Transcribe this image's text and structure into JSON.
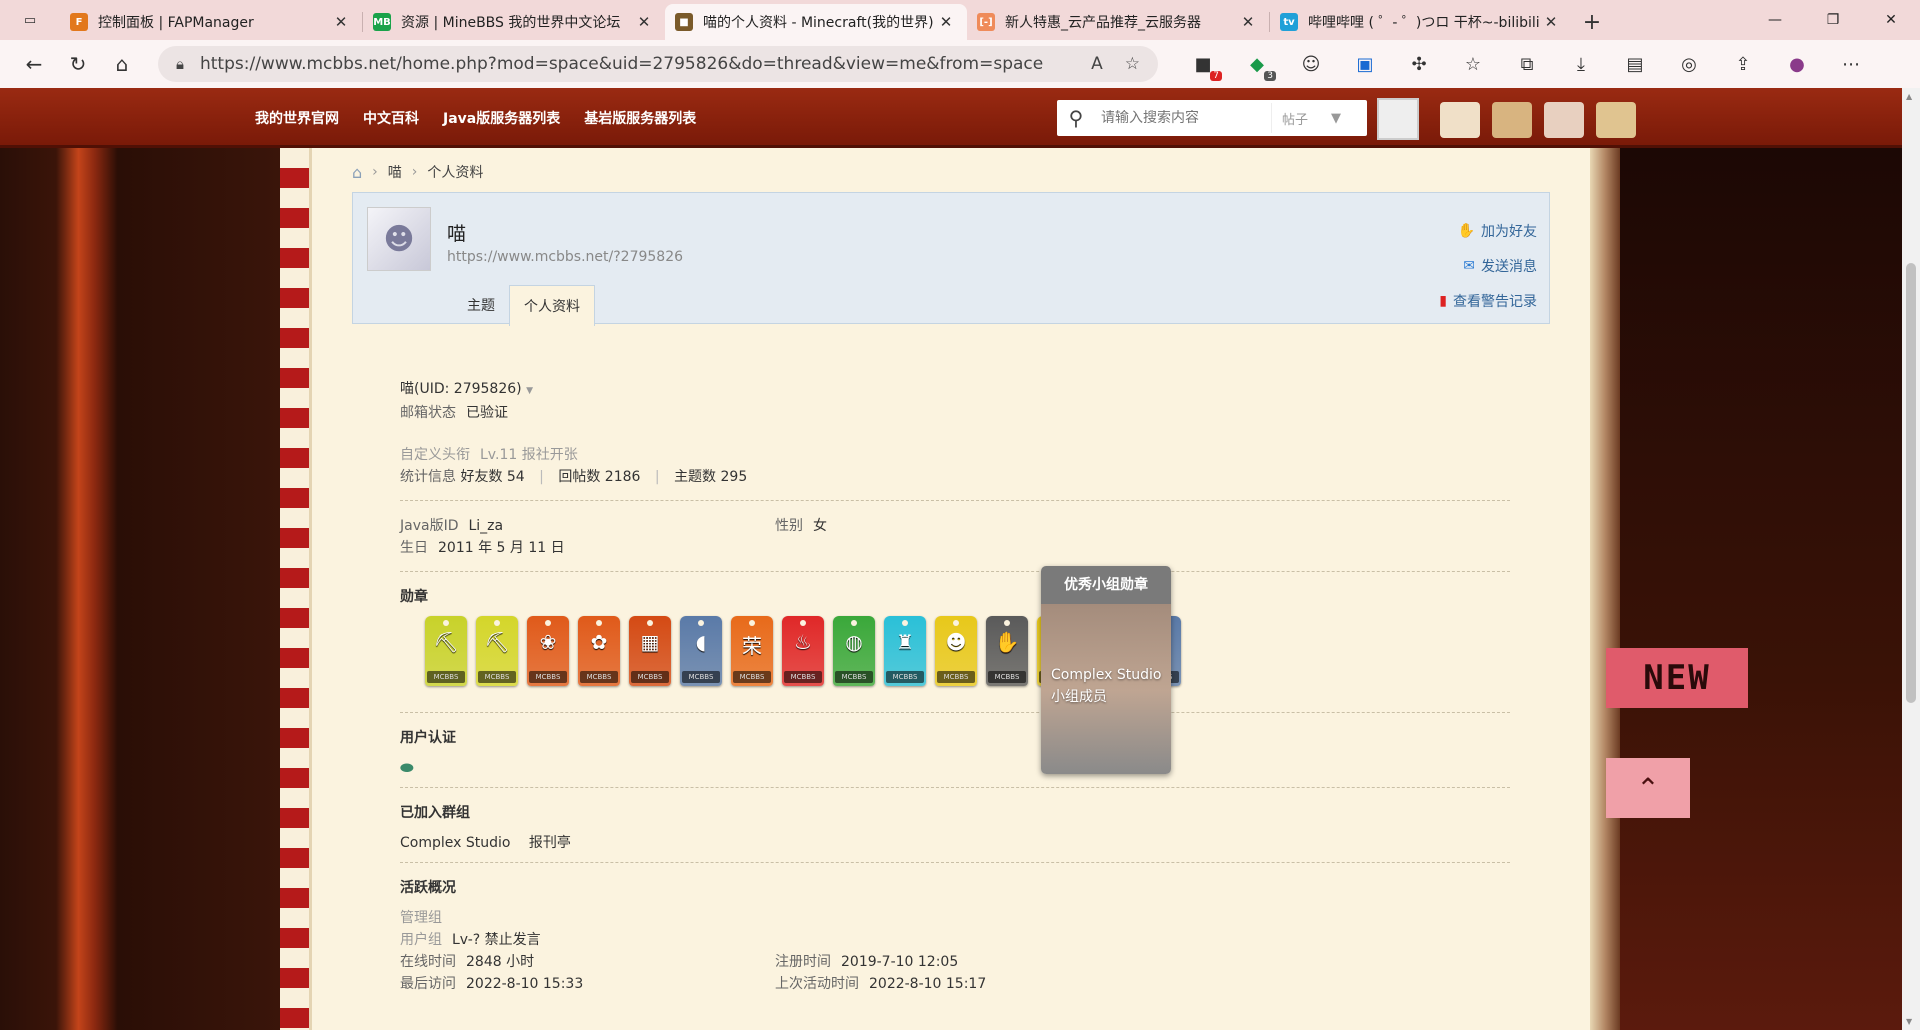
{
  "browser": {
    "tabs": [
      {
        "title": "控制面板 | FAPManager",
        "fav": "F",
        "color": "#e2781c",
        "active": false
      },
      {
        "title": "资源 | MineBBS 我的世界中文论坛",
        "fav": "MB",
        "color": "#1aa24a",
        "active": false
      },
      {
        "title": "喵的个人资料 - Minecraft(我的世界)",
        "fav": "■",
        "color": "#7a5a2a",
        "active": true
      },
      {
        "title": "新人特惠_云产品推荐_云服务器",
        "fav": "[-]",
        "color": "#ef8b5a",
        "active": false
      },
      {
        "title": "哔哩哔哩 ( ゜- ゜)つロ 干杯~-bilibili",
        "fav": "tv",
        "color": "#20a0d8",
        "active": false
      }
    ],
    "url": "https://www.mcbbs.net/home.php?mod=space&uid=2795826&do=thread&view=me&from=space",
    "ext_badges": {
      "a": "7",
      "b": "3"
    }
  },
  "nav": {
    "links": [
      "我的世界官网",
      "中文百科",
      "Java版服务器列表",
      "基岩版服务器列表"
    ],
    "search_placeholder": "请输入搜索内容",
    "search_type": "帖子"
  },
  "breadcrumb": [
    "喵",
    "个人资料"
  ],
  "profile": {
    "name": "喵",
    "url": "https://www.mcbbs.net/?2795826",
    "tabs": [
      "主题",
      "个人资料"
    ],
    "actions": [
      "加为好友",
      "发送消息",
      "查看警告记录"
    ]
  },
  "info": {
    "uid_line": "喵(UID: 2795826)",
    "email_label": "邮箱状态",
    "email_value": "已验证",
    "custom_title_label": "自定义头衔",
    "custom_title_value": "Lv.11 报社开张",
    "stats_label": "统计信息",
    "friends": "好友数 54",
    "replies": "回帖数 2186",
    "threads": "主题数 295",
    "java_label": "Java版ID",
    "java_value": "Li_za",
    "gender_label": "性别",
    "gender_value": "女",
    "birthday_label": "生日",
    "birthday_value": "2011 年 5 月 11 日",
    "medals_title": "勋章",
    "medal_tag": "MCBBS",
    "auth_title": "用户认证",
    "groups_title": "已加入群组",
    "group1": "Complex Studio",
    "group2": "报刊亭",
    "activity_title": "活跃概况",
    "admin_group": "管理组",
    "user_group_label": "用户组",
    "user_group_value": "Lv-? 禁止发言",
    "online_label": "在线时间",
    "online_value": "2848 小时",
    "reg_label": "注册时间",
    "reg_value": "2019-7-10 12:05",
    "last_visit_label": "最后访问",
    "last_visit_value": "2022-8-10 15:33",
    "last_active_label": "上次活动时间",
    "last_active_value": "2022-8-10 15:17"
  },
  "tooltip": {
    "title": "优秀小组勋章",
    "line1": "Complex Studio",
    "line2": "小组成员"
  },
  "medals": [
    {
      "color": "#c8d22a",
      "glyph": "⛏"
    },
    {
      "color": "#d4d62a",
      "glyph": "⛏"
    },
    {
      "color": "#e05a1a",
      "glyph": "❀"
    },
    {
      "color": "#e05a1a",
      "glyph": "✿"
    },
    {
      "color": "#d44a14",
      "glyph": "▦"
    },
    {
      "color": "#5a7aa8",
      "glyph": "◖"
    },
    {
      "color": "#e86a1a",
      "glyph": "荣"
    },
    {
      "color": "#e02828",
      "glyph": "♨"
    },
    {
      "color": "#3aa83a",
      "glyph": "◍"
    },
    {
      "color": "#2ac0d8",
      "glyph": "♜"
    },
    {
      "color": "#e8c81a",
      "glyph": "☻"
    },
    {
      "color": "#5a5a5a",
      "glyph": "✋"
    },
    {
      "color": "#e8c81a",
      "glyph": "♪"
    },
    {
      "color": "#3a3a3a",
      "glyph": "✺"
    },
    {
      "color": "#5a7aa8",
      "glyph": "●"
    }
  ],
  "decor": {
    "new_flag": "NEW"
  }
}
